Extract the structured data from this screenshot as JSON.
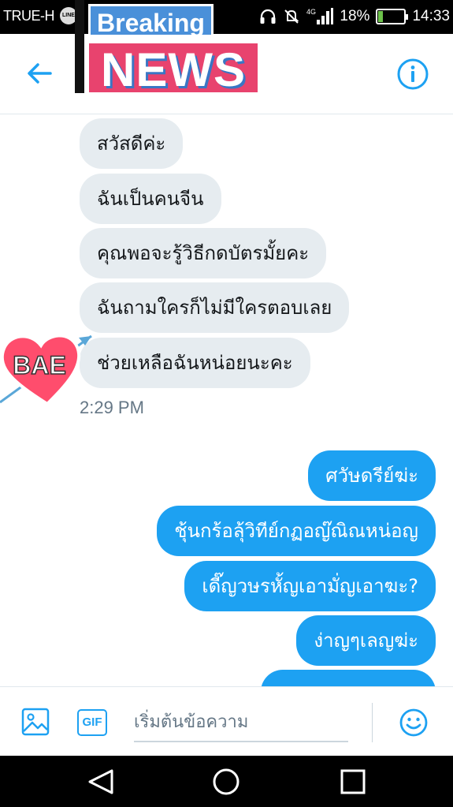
{
  "status_bar": {
    "carrier": "TRUE-H",
    "network": "4G",
    "battery_percent": "18%",
    "battery_level": 0.18,
    "time": "14:33",
    "icons": [
      "line-app-icon",
      "headphones-icon",
      "mute-icon",
      "signal-icon",
      "battery-charging-icon"
    ]
  },
  "sticker": {
    "breaking": "Breaking",
    "news": "NEWS",
    "bae": "BAE"
  },
  "header": {
    "back_icon": "arrow-left-icon",
    "info_icon": "info-icon"
  },
  "chat": {
    "incoming": [
      "สวัสดีค่ะ",
      "ฉันเป็นคนจีน",
      "คุณพอจะรู้วิธีกดบัตรมั้ยคะ",
      "ฉันถามใครก็ไม่มีใครตอบเลย",
      "ช่วยเหลือฉันหน่อยนะคะ"
    ],
    "timestamp": "2:29 PM",
    "outgoing": [
      "ศวัษดรีย์ฆ่ะ",
      "ชุ้นกร้อลุ้วิทีย์กฏอญ๊ณิณหน่อญ",
      "เดี๊ญวษรหั้ญเอามั่ญเอาฆะ?",
      "ง่าญๆเลญฆ่ะ"
    ]
  },
  "composer": {
    "gif_label": "GIF",
    "placeholder": "เริ่มต้นข้อความ",
    "value": ""
  },
  "colors": {
    "accent": "#1da1f2",
    "incoming_bubble": "#e6ecf0",
    "news_red": "#e8436e",
    "breaking_blue": "#4a90d9"
  }
}
